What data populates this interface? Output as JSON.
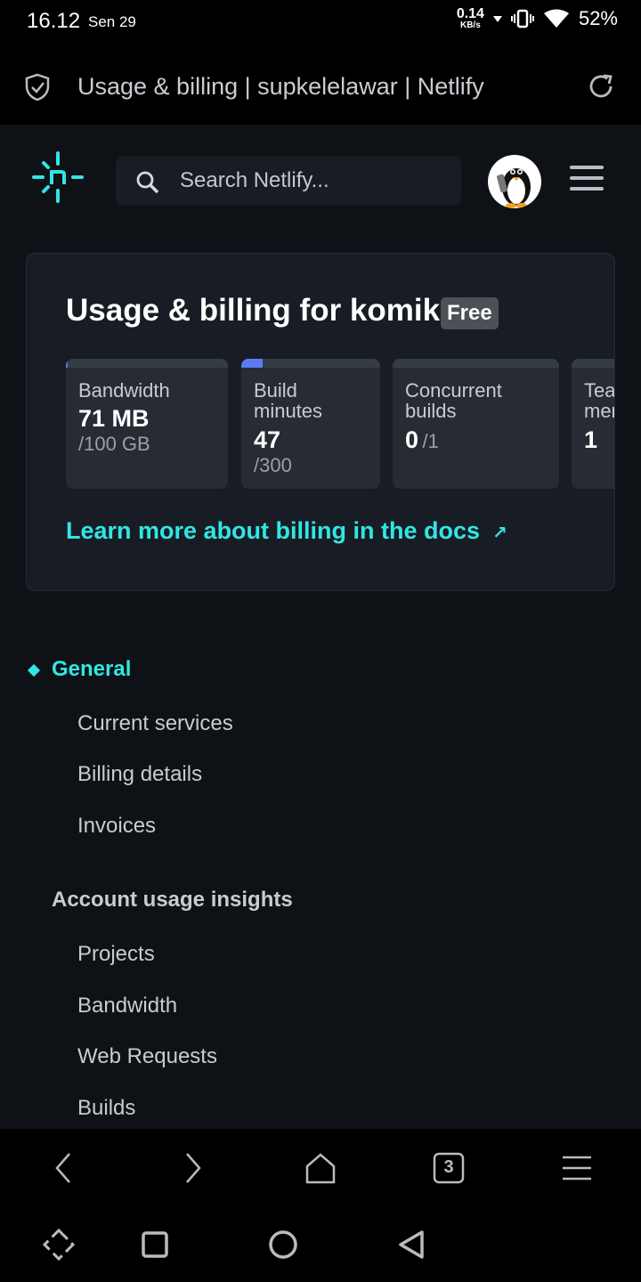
{
  "status": {
    "time": "16.12",
    "day": "Sen 29",
    "net_speed": "0.14",
    "net_unit": "KB/s",
    "battery": "52%"
  },
  "browser": {
    "page_title": "Usage & billing | supkelelawar | Netlify",
    "tab_count": "3"
  },
  "header": {
    "search_placeholder": "Search Netlify..."
  },
  "usage": {
    "title": "Usage & billing for komik",
    "plan_badge": "Free",
    "stats": [
      {
        "label": "Bandwidth",
        "value": "71 MB",
        "limit": "/100 GB",
        "progress": 0.0007
      },
      {
        "label": "Build minutes",
        "value": "47",
        "limit": "/300",
        "progress": 0.157
      },
      {
        "label": "Concurrent builds",
        "value": "0",
        "limit": "/1",
        "progress": 0
      },
      {
        "label": "Team memb",
        "value": "1",
        "limit": "",
        "progress": 0
      }
    ],
    "learn_more": "Learn more about billing in the docs",
    "learn_more_arrow": "↗"
  },
  "nav": {
    "general": {
      "title": "General",
      "items": [
        "Current services",
        "Billing details",
        "Invoices"
      ]
    },
    "insights": {
      "title": "Account usage insights",
      "items": [
        "Projects",
        "Bandwidth",
        "Web Requests",
        "Builds"
      ]
    }
  },
  "colors": {
    "accent": "#32e6e2",
    "background": "#0e1116",
    "card": "#181c24",
    "progress": "#5a7cf2"
  }
}
